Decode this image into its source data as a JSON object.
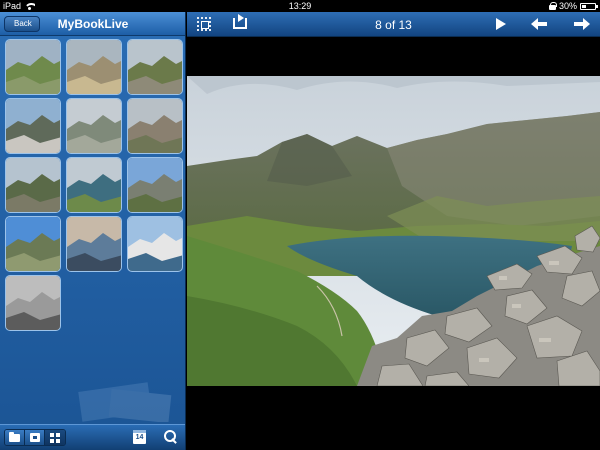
{
  "status_bar": {
    "device": "iPad",
    "time": "13:29",
    "battery_percent": "30%",
    "battery_level": 0.3
  },
  "sidebar": {
    "back_label": "Back",
    "title": "MyBookLive",
    "thumbnails": [
      {
        "name": "thumb-1",
        "scene": "valley-hills"
      },
      {
        "name": "thumb-2",
        "scene": "summit-plaque"
      },
      {
        "name": "thumb-3",
        "scene": "mountain-path"
      },
      {
        "name": "thumb-4",
        "scene": "village-street"
      },
      {
        "name": "thumb-5",
        "scene": "misty-ridge"
      },
      {
        "name": "thumb-6",
        "scene": "rocky-slope"
      },
      {
        "name": "thumb-7",
        "scene": "ridge-panorama"
      },
      {
        "name": "thumb-8",
        "scene": "mountain-lake"
      },
      {
        "name": "thumb-9",
        "scene": "rocky-peak"
      },
      {
        "name": "thumb-10",
        "scene": "ridge-blue-sky"
      },
      {
        "name": "thumb-11",
        "scene": "lake-sunset"
      },
      {
        "name": "thumb-12",
        "scene": "harbour-boats"
      },
      {
        "name": "thumb-13",
        "scene": "foggy-summit"
      }
    ],
    "toolbar": {
      "icons": [
        "folder-icon",
        "device-icon",
        "grid-view-icon",
        "calendar-icon",
        "search-icon"
      ],
      "calendar_day": "14",
      "active_view": "grid"
    }
  },
  "viewer": {
    "counter": "8 of 13",
    "icons": [
      "fullscreen-icon",
      "share-icon",
      "play-icon",
      "prev-arrow-icon",
      "next-arrow-icon"
    ],
    "photo_scene": "mountain-lake-with-rock-cairn"
  }
}
